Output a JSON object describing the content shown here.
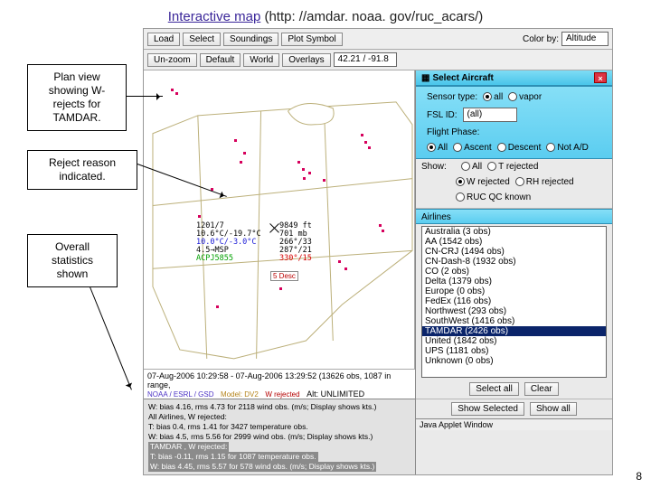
{
  "title_link": "Interactive map",
  "title_url": " (http: //amdar. noaa. gov/ruc_acars/)",
  "annot1": "Plan view\nshowing W-\nrejects for\nTAMDAR.",
  "annot2": "Reject reason\nindicated.",
  "annot3": "Overall\nstatistics\nshown",
  "toolbar": {
    "load": "Load",
    "select": "Select",
    "soundings": "Soundings",
    "plotsym": "Plot Symbol",
    "unzoom": "Un-zoom",
    "default": "Default",
    "world": "World",
    "overlays": "Overlays",
    "colorby_lbl": "Color by:",
    "colorby_val": "Altitude",
    "coords": "42.21 / -91.8"
  },
  "readout": {
    "l1a": "1201/7",
    "l1b": "9849 ft",
    "l2a": "10.6°C/-19.7°C",
    "l2b": "701 mb",
    "l3a": "10.0°C/-3.0°C",
    "l3b": "266°/33",
    "l4a": "4.5→MSP",
    "l4b": "287°/21",
    "l5a": "ACPJ5855",
    "l5b": "330°/15",
    "popup": "5 Desc"
  },
  "timebar": {
    "range": "07-Aug-2006 10:29:58 - 07-Aug-2006 13:29:52 (13626 obs, 1087 in range,",
    "provider": "NOAA / ESRL / GSD",
    "model_lbl": "Model: DV2",
    "wrej": "W rejected",
    "alt": "Alt:  UNLIMITED"
  },
  "stats": {
    "l1": "W: bias 4.16, rms 4.73 for 2118 wind obs. (m/s; Display shows kts.)",
    "l2": "All Airlines, W rejected:",
    "l3": "T: bias 0.4, rms 1.41 for 3427 temperature obs.",
    "l4": "W: bias 4.5, rms 5.56 for 2999 wind obs. (m/s; Display shows kts.)",
    "h1": "TAMDAR , W rejected:",
    "h2": "T: bias -0.11, rms 1.15 for 1087 temperature obs.",
    "h3": "W: bias 4.45, rms 5.57 for 578 wind obs. (m/s; Display shows kts.)"
  },
  "side": {
    "title": "Select Aircraft",
    "sensor_lbl": "Sensor type:",
    "sensor_all": "all",
    "sensor_vapor": "vapor",
    "fsl_lbl": "FSL ID:",
    "fsl_val": "(all)",
    "fp_lbl": "Flight Phase:",
    "fp_all": "All",
    "fp_asc": "Ascent",
    "fp_desc": "Descent",
    "fp_na": "Not A/D",
    "show_lbl": "Show:",
    "show_all": "All",
    "show_trej": "T rejected",
    "show_wrej": "W rejected",
    "show_rhrej": "RH rejected",
    "show_ruc": "RUC QC known",
    "air_lbl": "Airlines",
    "airlines": [
      "Australia (3 obs)",
      "AA (1542 obs)",
      "CN-CRJ (1494 obs)",
      "CN-Dash-8 (1932 obs)",
      "CO (2 obs)",
      "Delta (1379 obs)",
      "Europe (0 obs)",
      "FedEx (116 obs)",
      "Northwest (293 obs)",
      "SouthWest (1416 obs)",
      "TAMDAR (2426 obs)",
      "United (1842 obs)",
      "UPS (1181 obs)",
      "Unknown (0 obs)"
    ],
    "air_selected_index": 10,
    "selall": "Select all",
    "clear": "Clear",
    "showsel": "Show Selected",
    "showall": "Show all"
  },
  "java_footer": "Java Applet Window",
  "pagenum": "8"
}
